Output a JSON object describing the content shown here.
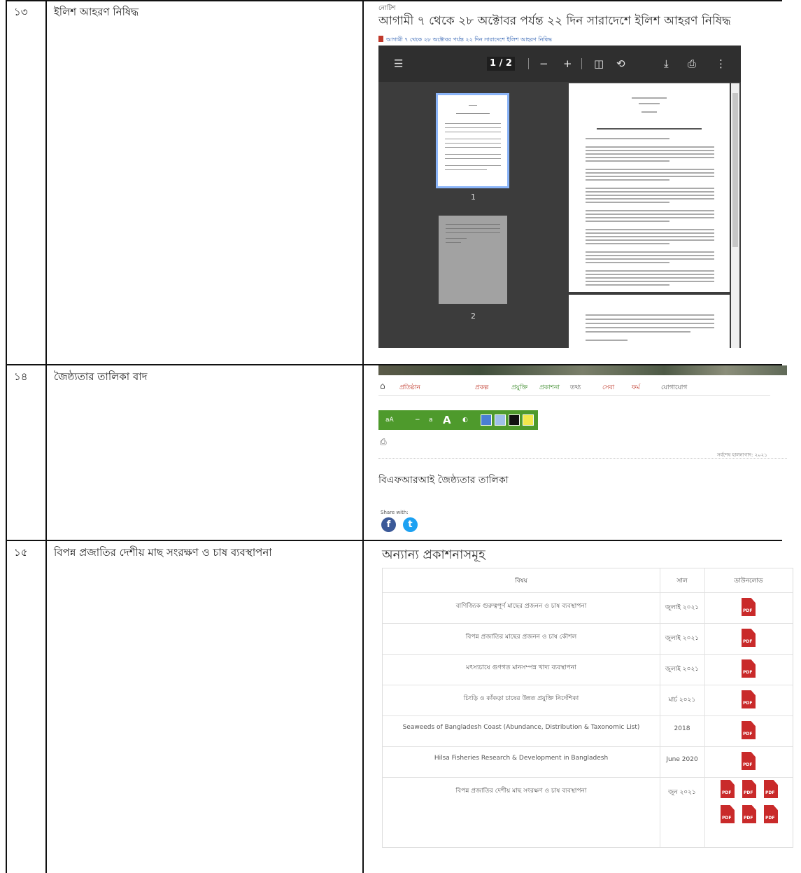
{
  "rows": [
    {
      "num": "১৩",
      "title": "ইলিশ আহরণ নিষিদ্ধ"
    },
    {
      "num": "১৪",
      "title": "জৈষ্ঠ্যতার তালিকা বাদ"
    },
    {
      "num": "১৫",
      "title": "বিপন্ন প্রজাতির দেশীয় মাছ সংরক্ষণ ও চাষ ব্যবস্থাপনা"
    }
  ],
  "pdf_screen": {
    "small_label": "নোটিশ",
    "headline": "আগামী ৭ থেকে ২৮ অক্টোবর পর্যন্ত ২২ দিন সারাদেশে ইলিশ আহরণ নিষিদ্ধ",
    "link_text": "আগামী ৭ থেকে ২৮ অক্টোবর পর্যন্ত ২২ দিন সারাদেশে ইলিশ আহরণ নিষিদ্ধ",
    "page_indicator": "1 / 2",
    "thumb_labels": [
      "1",
      "2"
    ]
  },
  "web_screen": {
    "nav_items": [
      "প্রতিষ্ঠান",
      "প্রকল্প",
      "প্রযুক্তি",
      "প্রকাশনা",
      "তথ্য",
      "সেবা",
      "ফর্ম",
      "যোগাযোগ"
    ],
    "date_text": "সর্বশেষ হালনাগাদ: ২০২১",
    "heading": "বিএফআরআই জৈষ্ঠ্যতার তালিকা",
    "share_label": "Share with:"
  },
  "pubs": {
    "heading": "অন্যান্য প্রকাশনাসমূহ",
    "headers": [
      "বিষয়",
      "সাল",
      "ডাউনলোড"
    ],
    "items": [
      {
        "title": "বাণিজ্যিক গুরুত্বপূর্ণ মাছের প্রজনন ও চাষ ব্যবস্থাপনা",
        "date": "জুলাই ২০২১",
        "pdfs": 1
      },
      {
        "title": "বিপন্ন প্রজাতির মাছের প্রজনন ও চাষ কৌশল",
        "date": "জুলাই ২০২১",
        "pdfs": 1
      },
      {
        "title": "মৎস্যচাষে গুণগত মানসম্পন্ন খাদ্য ব্যবস্থাপনা",
        "date": "জুলাই ২০২১",
        "pdfs": 1
      },
      {
        "title": "চিংড়ি ও কাঁকড়া চাষের উন্নত প্রযুক্তি নির্দেশিকা",
        "date": "মার্চ ২০২১",
        "pdfs": 1
      },
      {
        "title": "Seaweeds of Bangladesh Coast (Abundance, Distribution & Taxonomic List)",
        "date": "2018",
        "pdfs": 1
      },
      {
        "title": "Hilsa Fisheries Research & Development in Bangladesh",
        "date": "June 2020",
        "pdfs": 1
      },
      {
        "title": "বিপন্ন প্রজাতির দেশীয় মাছ সংরক্ষণ ও চাষ ব্যবস্থাপনা",
        "date": "জুন ২০২১",
        "pdfs": 6
      }
    ]
  }
}
